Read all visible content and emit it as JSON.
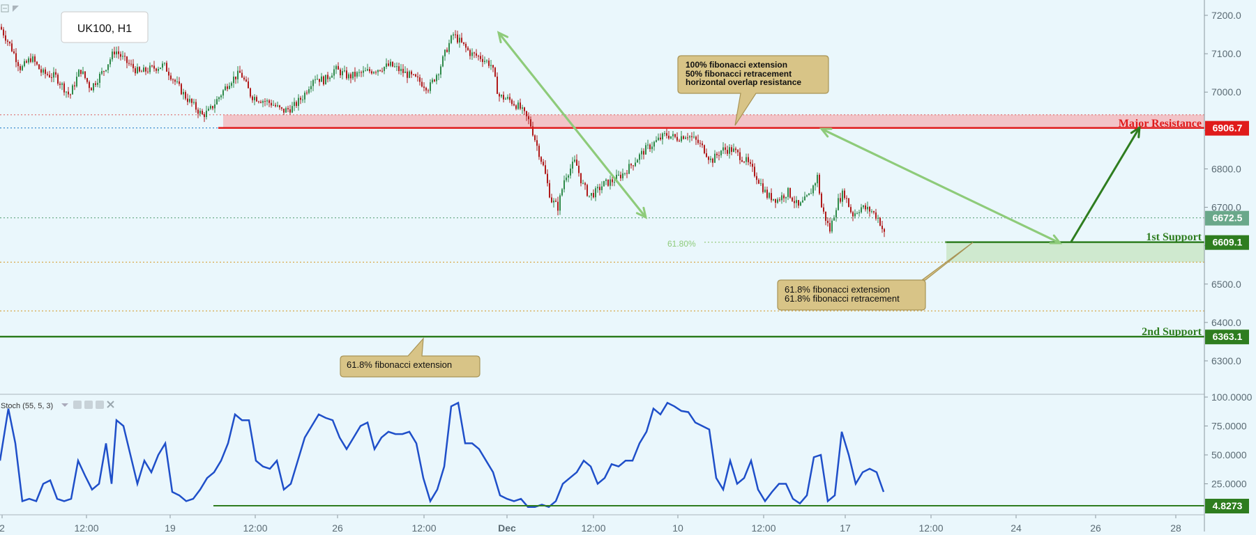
{
  "symbol": "UK100, H1",
  "colors": {
    "background": "#eaf7fc",
    "resistance": "#e01b1b",
    "resistance_zone": "#f2c4c8",
    "support": "#2e7d1f",
    "support_zone": "#cfe9cf",
    "current_price": "#6aa88a",
    "arrow_green": "#8ecb7a",
    "stoch_line": "#1f4fc9",
    "callout_fill": "#d8c487",
    "callout_border": "#a89456",
    "up_candle": "#2f8a4a",
    "down_candle": "#b01a1a"
  },
  "chart_data": [
    {
      "type": "candlestick",
      "instrument": "UK100",
      "timeframe": "H1",
      "ylim": [
        6230,
        7240
      ],
      "y_ticks": [
        7200,
        7100,
        7000,
        6900,
        6800,
        6700,
        6600,
        6500,
        6400,
        6300
      ],
      "y_tick_labels": [
        "7200.0",
        "7100.0",
        "7000.0",
        "6900.0",
        "6800.0",
        "6700.0",
        "6600.0",
        "6500.0",
        "6400.0",
        "6300.0"
      ],
      "x_tick_labels": [
        "2",
        "12:00",
        "19",
        "12:00",
        "26",
        "12:00",
        "Dec",
        "12:00",
        "10",
        "12:00",
        "17",
        "12:00",
        "24",
        "26",
        "28"
      ],
      "close_path": [
        [
          0,
          7170
        ],
        [
          15,
          7120
        ],
        [
          30,
          7060
        ],
        [
          45,
          7090
        ],
        [
          60,
          7050
        ],
        [
          80,
          7040
        ],
        [
          100,
          6990
        ],
        [
          115,
          7060
        ],
        [
          130,
          7010
        ],
        [
          150,
          7060
        ],
        [
          165,
          7110
        ],
        [
          180,
          7080
        ],
        [
          200,
          7050
        ],
        [
          215,
          7060
        ],
        [
          235,
          7070
        ],
        [
          250,
          7030
        ],
        [
          265,
          6990
        ],
        [
          280,
          6960
        ],
        [
          290,
          6940
        ],
        [
          300,
          6950
        ],
        [
          315,
          6990
        ],
        [
          330,
          7030
        ],
        [
          345,
          7050
        ],
        [
          360,
          6990
        ],
        [
          375,
          6980
        ],
        [
          390,
          6970
        ],
        [
          405,
          6950
        ],
        [
          420,
          6960
        ],
        [
          435,
          6990
        ],
        [
          450,
          7040
        ],
        [
          465,
          7030
        ],
        [
          480,
          7060
        ],
        [
          500,
          7040
        ],
        [
          520,
          7050
        ],
        [
          540,
          7060
        ],
        [
          560,
          7070
        ],
        [
          580,
          7050
        ],
        [
          600,
          7030
        ],
        [
          615,
          7010
        ],
        [
          630,
          7060
        ],
        [
          640,
          7110
        ],
        [
          650,
          7150
        ],
        [
          660,
          7130
        ],
        [
          675,
          7100
        ],
        [
          690,
          7090
        ],
        [
          705,
          7070
        ],
        [
          715,
          6990
        ],
        [
          730,
          6980
        ],
        [
          745,
          6960
        ],
        [
          760,
          6920
        ],
        [
          770,
          6860
        ],
        [
          780,
          6800
        ],
        [
          790,
          6720
        ],
        [
          800,
          6700
        ],
        [
          810,
          6780
        ],
        [
          825,
          6820
        ],
        [
          835,
          6760
        ],
        [
          845,
          6730
        ],
        [
          855,
          6740
        ],
        [
          865,
          6760
        ],
        [
          880,
          6770
        ],
        [
          895,
          6790
        ],
        [
          910,
          6820
        ],
        [
          925,
          6850
        ],
        [
          940,
          6870
        ],
        [
          955,
          6890
        ],
        [
          970,
          6880
        ],
        [
          985,
          6890
        ],
        [
          1000,
          6870
        ],
        [
          1010,
          6850
        ],
        [
          1020,
          6820
        ],
        [
          1035,
          6850
        ],
        [
          1050,
          6850
        ],
        [
          1070,
          6820
        ],
        [
          1085,
          6780
        ],
        [
          1100,
          6730
        ],
        [
          1115,
          6720
        ],
        [
          1130,
          6740
        ],
        [
          1145,
          6700
        ],
        [
          1160,
          6730
        ],
        [
          1172,
          6780
        ],
        [
          1178,
          6700
        ],
        [
          1190,
          6640
        ],
        [
          1200,
          6710
        ],
        [
          1210,
          6740
        ],
        [
          1222,
          6680
        ],
        [
          1235,
          6700
        ],
        [
          1250,
          6690
        ],
        [
          1260,
          6670
        ],
        [
          1268,
          6630
        ]
      ],
      "highs_lows": {
        "high": 7155,
        "low": 6630
      },
      "levels": [
        {
          "label": "Major Resistance",
          "value": 6906.7,
          "value_label": "6906.7"
        },
        {
          "label": "1st Support",
          "value": 6609.1,
          "value_label": "6609.1"
        },
        {
          "label": "2nd Support",
          "value": 6363.1,
          "value_label": "6363.1"
        }
      ],
      "current_price": {
        "value": 6672.5,
        "label": "6672.5"
      },
      "dotted_levels": [
        6941,
        6906.7,
        6672.5,
        6609.1,
        6557,
        6430
      ],
      "fib_label": "61.80%",
      "annotations": [
        {
          "lines": [
            "100% fibonacci extension",
            "50% fibonacci retracement",
            "horizontal overlap resistance"
          ]
        },
        {
          "lines": [
            "61.8% fibonacci extension",
            "61.8% fibonacci retracement"
          ]
        },
        {
          "lines": [
            "61.8% fibonacci extension"
          ]
        }
      ]
    },
    {
      "type": "line",
      "title": "Stoch (55, 5, 3)",
      "ylim": [
        0,
        100
      ],
      "y_ticks": [
        100,
        75,
        50,
        25
      ],
      "y_tick_labels": [
        "100.0000",
        "75.0000",
        "50.0000",
        "25.0000"
      ],
      "level": {
        "value": 4.8273,
        "label": "4.8273"
      },
      "series": [
        {
          "points": [
            [
              0,
              45
            ],
            [
              12,
              90
            ],
            [
              22,
              60
            ],
            [
              32,
              10
            ],
            [
              42,
              12
            ],
            [
              52,
              10
            ],
            [
              62,
              25
            ],
            [
              72,
              28
            ],
            [
              82,
              12
            ],
            [
              92,
              10
            ],
            [
              102,
              12
            ],
            [
              112,
              45
            ],
            [
              122,
              32
            ],
            [
              132,
              20
            ],
            [
              142,
              25
            ],
            [
              152,
              60
            ],
            [
              160,
              25
            ],
            [
              167,
              80
            ],
            [
              177,
              75
            ],
            [
              187,
              50
            ],
            [
              197,
              25
            ],
            [
              207,
              45
            ],
            [
              217,
              35
            ],
            [
              227,
              50
            ],
            [
              237,
              60
            ],
            [
              247,
              18
            ],
            [
              257,
              15
            ],
            [
              267,
              10
            ],
            [
              277,
              12
            ],
            [
              287,
              20
            ],
            [
              297,
              30
            ],
            [
              307,
              35
            ],
            [
              317,
              45
            ],
            [
              327,
              60
            ],
            [
              337,
              85
            ],
            [
              347,
              80
            ],
            [
              357,
              80
            ],
            [
              367,
              45
            ],
            [
              377,
              40
            ],
            [
              387,
              38
            ],
            [
              397,
              45
            ],
            [
              407,
              20
            ],
            [
              417,
              25
            ],
            [
              427,
              45
            ],
            [
              437,
              65
            ],
            [
              447,
              75
            ],
            [
              457,
              85
            ],
            [
              467,
              82
            ],
            [
              477,
              80
            ],
            [
              487,
              65
            ],
            [
              497,
              55
            ],
            [
              507,
              65
            ],
            [
              517,
              75
            ],
            [
              527,
              78
            ],
            [
              537,
              55
            ],
            [
              547,
              65
            ],
            [
              557,
              70
            ],
            [
              567,
              68
            ],
            [
              577,
              68
            ],
            [
              587,
              70
            ],
            [
              597,
              60
            ],
            [
              607,
              30
            ],
            [
              617,
              10
            ],
            [
              627,
              20
            ],
            [
              637,
              40
            ],
            [
              647,
              92
            ],
            [
              657,
              95
            ],
            [
              667,
              60
            ],
            [
              677,
              60
            ],
            [
              687,
              55
            ],
            [
              697,
              45
            ],
            [
              707,
              35
            ],
            [
              717,
              15
            ],
            [
              727,
              12
            ],
            [
              737,
              10
            ],
            [
              747,
              12
            ],
            [
              757,
              5
            ],
            [
              767,
              5
            ],
            [
              777,
              7
            ],
            [
              787,
              5
            ],
            [
              797,
              10
            ],
            [
              807,
              25
            ],
            [
              817,
              30
            ],
            [
              827,
              35
            ],
            [
              837,
              45
            ],
            [
              847,
              40
            ],
            [
              857,
              25
            ],
            [
              867,
              30
            ],
            [
              877,
              42
            ],
            [
              887,
              40
            ],
            [
              897,
              45
            ],
            [
              907,
              45
            ],
            [
              917,
              60
            ],
            [
              927,
              70
            ],
            [
              937,
              90
            ],
            [
              947,
              85
            ],
            [
              957,
              95
            ],
            [
              967,
              92
            ],
            [
              977,
              88
            ],
            [
              987,
              87
            ],
            [
              997,
              78
            ],
            [
              1007,
              75
            ],
            [
              1017,
              72
            ],
            [
              1027,
              30
            ],
            [
              1037,
              20
            ],
            [
              1047,
              45
            ],
            [
              1057,
              25
            ],
            [
              1067,
              30
            ],
            [
              1077,
              45
            ],
            [
              1087,
              20
            ],
            [
              1097,
              10
            ],
            [
              1107,
              18
            ],
            [
              1117,
              25
            ],
            [
              1127,
              25
            ],
            [
              1137,
              12
            ],
            [
              1147,
              8
            ],
            [
              1157,
              15
            ],
            [
              1167,
              48
            ],
            [
              1177,
              50
            ],
            [
              1187,
              10
            ],
            [
              1197,
              15
            ],
            [
              1207,
              70
            ],
            [
              1217,
              50
            ],
            [
              1227,
              25
            ],
            [
              1237,
              35
            ],
            [
              1247,
              38
            ],
            [
              1257,
              35
            ],
            [
              1267,
              18
            ]
          ]
        }
      ]
    }
  ]
}
